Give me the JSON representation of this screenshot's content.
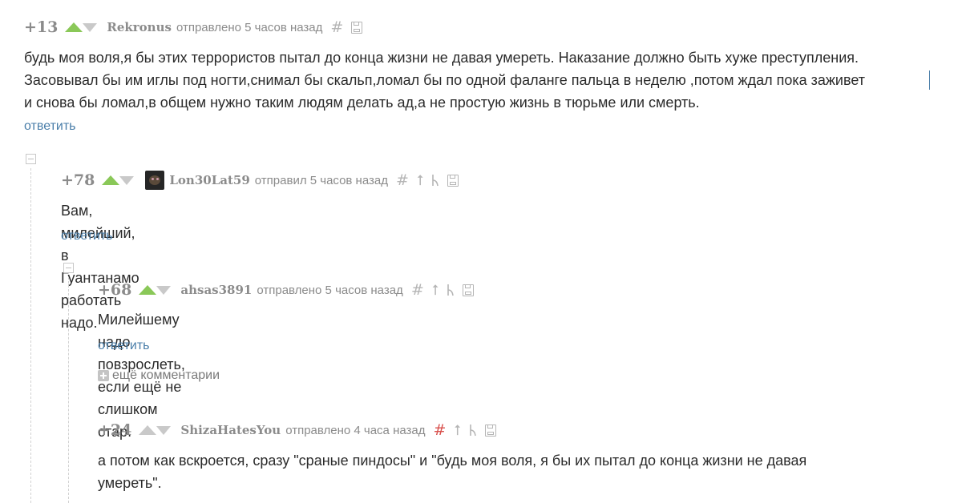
{
  "comments": [
    {
      "rating": "+13",
      "author": "Rekronus",
      "posted": "отправлено 5 часов назад",
      "lines": [
        "будь моя воля,я бы этих террористов пытал до конца жизни не давая умереть. Наказание должно быть хуже преступления.",
        "Засовывал бы им иглы под ногти,снимал бы скальп,ломал бы по одной фаланге пальца в неделю ,потом ждал пока заживет",
        "и снова бы ломал,в общем нужно таким людям делать ад,а не простую жизнь в тюрьме или смерть."
      ],
      "reply_label": "ответить"
    },
    {
      "rating": "+78",
      "author": "Lon30Lat59",
      "posted": "отправил 5 часов назад",
      "lines": [
        "Вам, милейший, в Гуантанамо работать надо."
      ],
      "reply_label": "ответить"
    },
    {
      "rating": "+68",
      "author": "ahsas3891",
      "posted": "отправлено 5 часов назад",
      "lines": [
        "Милейшему надо повзрослеть, если ещё не слишком стар."
      ],
      "reply_label": "ответить"
    },
    {
      "rating": "+24",
      "author": "ShizaHatesYou",
      "posted": "отправлено 4 часа назад",
      "lines": [
        "а потом как вскроется, сразу \"сраные пиндосы\" и \"будь моя воля, я бы их пытал до конца жизни не давая",
        "умереть\"."
      ]
    }
  ],
  "more_comments_label": "ещё комментарии",
  "icons": {
    "hash": "#",
    "up_arrow": "⭡",
    "branch": "⼁"
  },
  "colors": {
    "upvote": "#8ac858",
    "link": "#4a7ea9",
    "meta": "#8b8b8b",
    "hash_active": "#d9534f"
  }
}
